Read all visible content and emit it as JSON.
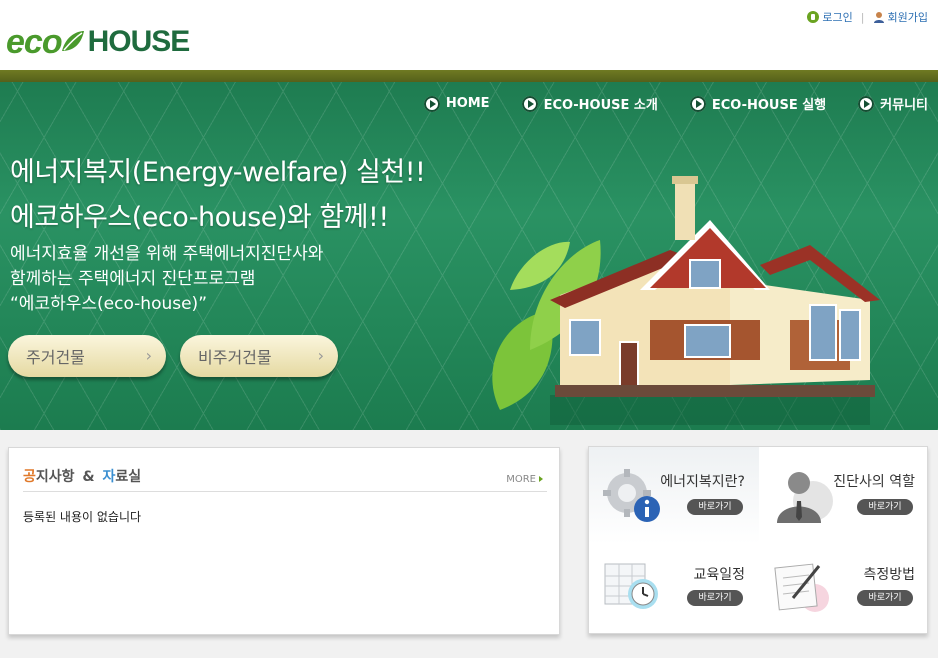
{
  "header": {
    "logo_eco": "eco",
    "logo_house": "HOUSE",
    "login": "로그인",
    "signup": "회원가입"
  },
  "nav": {
    "items": [
      {
        "label": "HOME"
      },
      {
        "label": "ECO-HOUSE 소개"
      },
      {
        "label": "ECO-HOUSE 실행"
      },
      {
        "label": "커뮤니티"
      }
    ]
  },
  "hero": {
    "headline_1": "에너지복지(Energy-welfare) 실천!!",
    "headline_2": "에코하우스(eco-house)와 함께!!",
    "desc_1": "에너지효율 개선을 위해 주택에너지진단사와",
    "desc_2": "함께하는 주택에너지 진단프로그램",
    "desc_3": "“에코하우스(eco-house)”",
    "button_residential": "주거건물",
    "button_nonresidential": "비주거건물"
  },
  "notice": {
    "title_c1": "공",
    "title_r1": "지사항",
    "title_amp": "&",
    "title_c2": "자",
    "title_r2": "료실",
    "more": "MORE",
    "empty": "등록된 내용이 없습니다"
  },
  "quick": {
    "items": [
      {
        "label": "에너지복지란?",
        "button": "바로가기",
        "icon": "gear-info-icon"
      },
      {
        "label": "진단사의 역할",
        "button": "바로가기",
        "icon": "person-icon"
      },
      {
        "label": "교육일정",
        "button": "바로가기",
        "icon": "calendar-clock-icon"
      },
      {
        "label": "측정방법",
        "button": "바로가기",
        "icon": "document-pen-icon"
      }
    ]
  },
  "colors": {
    "brand_green": "#1f6b3e",
    "hero_green": "#2a9263",
    "accent_orange": "#e0792a",
    "accent_blue": "#3a8fd1"
  }
}
